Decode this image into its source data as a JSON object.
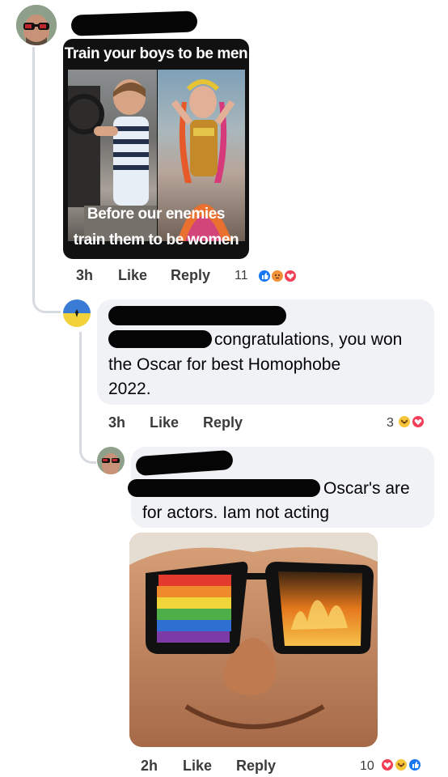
{
  "post_meme": {
    "top_caption": "Train your boys to be men",
    "bottom_caption_line1": "Before our enemies",
    "bottom_caption_line2": "train them to be women"
  },
  "comment1": {
    "time": "3h",
    "like_label": "Like",
    "reply_label": "Reply",
    "reaction_count": "11",
    "reactions": [
      "like",
      "angry",
      "love"
    ]
  },
  "comment2": {
    "text_line1": "congratulations, you won",
    "text_line2": "the Oscar for best Homophobe",
    "text_line3": "2022.",
    "time": "3h",
    "like_label": "Like",
    "reply_label": "Reply",
    "reaction_count": "3",
    "reactions": [
      "haha",
      "love"
    ]
  },
  "comment3": {
    "text_line1": "Oscar's are",
    "text_line2": "for actors. Iam not acting",
    "time": "2h",
    "like_label": "Like",
    "reply_label": "Reply",
    "reaction_count": "10",
    "reactions": [
      "love",
      "haha",
      "like"
    ]
  },
  "colors": {
    "bubble_bg": "#f0f2f5",
    "thread_line": "#d7dadf",
    "like_blue": "#1877f2",
    "love_red": "#f33e58",
    "haha_yellow": "#f7c53a",
    "angry_orange": "#f0913a"
  }
}
